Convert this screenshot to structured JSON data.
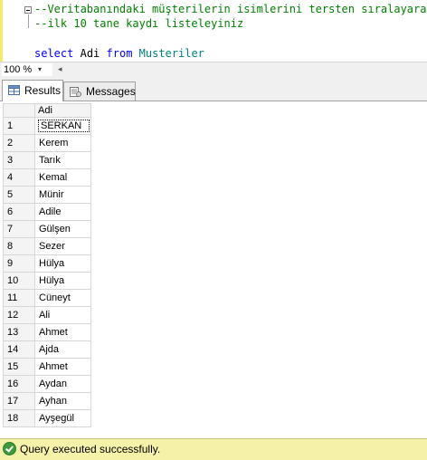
{
  "editor": {
    "line1": "--Veritabanındaki müşterilerin isimlerini tersten sıralayarak",
    "line2": "--ilk 10 tane kaydı listeleyiniz",
    "select_kw": "select",
    "column": "Adi",
    "from_kw": "from",
    "table": "Musteriler"
  },
  "zoom": {
    "value": "100 %",
    "arrow": "▾",
    "scroll_left": "◂"
  },
  "tabs": [
    {
      "label": "Results"
    },
    {
      "label": "Messages"
    }
  ],
  "grid": {
    "column_header": "Adi",
    "rows": [
      {
        "num": "1",
        "value": "SERKAN"
      },
      {
        "num": "2",
        "value": "Kerem"
      },
      {
        "num": "3",
        "value": "Tarık"
      },
      {
        "num": "4",
        "value": "Kemal"
      },
      {
        "num": "5",
        "value": "Münir"
      },
      {
        "num": "6",
        "value": "Adile"
      },
      {
        "num": "7",
        "value": "Gülşen"
      },
      {
        "num": "8",
        "value": "Sezer"
      },
      {
        "num": "9",
        "value": "Hülya"
      },
      {
        "num": "10",
        "value": "Hülya"
      },
      {
        "num": "11",
        "value": "Cüneyt"
      },
      {
        "num": "12",
        "value": "Ali"
      },
      {
        "num": "13",
        "value": "Ahmet"
      },
      {
        "num": "14",
        "value": "Ajda"
      },
      {
        "num": "15",
        "value": "Ahmet"
      },
      {
        "num": "16",
        "value": "Aydan"
      },
      {
        "num": "17",
        "value": "Ayhan"
      },
      {
        "num": "18",
        "value": "Ayşegül"
      }
    ]
  },
  "status": {
    "text": "Query executed successfully."
  }
}
